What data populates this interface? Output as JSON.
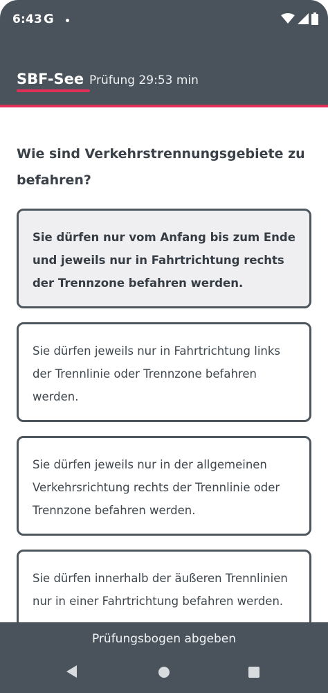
{
  "status_bar": {
    "time": "6:43",
    "google_glyph": "G",
    "icons": [
      "notification-dot",
      "wifi-icon",
      "signal-icon",
      "battery-icon"
    ]
  },
  "header": {
    "brand": "SBF-See",
    "exam_label": "Prüfung",
    "timer": "29:53 min"
  },
  "question": {
    "text": "Wie sind Verkehrstrennungsgebiete zu befahren?"
  },
  "answers": [
    {
      "text": "Sie dürfen nur vom Anfang bis zum Ende und jeweils nur in Fahrtrichtung rechts der Trennzone befahren werden.",
      "selected": true
    },
    {
      "text": "Sie dürfen jeweils nur in Fahrtrichtung links der Trennlinie oder Trennzone befahren werden.",
      "selected": false
    },
    {
      "text": "Sie dürfen jeweils nur in der allgemeinen Verkehrsrichtung rechts der Trennlinie oder Trennzone befahren werden.",
      "selected": false
    },
    {
      "text": "Sie dürfen innerhalb der äußeren Trennlinien nur in einer Fahrtrichtung befahren werden.",
      "selected": false
    }
  ],
  "footer": {
    "submit_label": "Prüfungsbogen abgeben"
  },
  "colors": {
    "header_bg": "#4a535b",
    "accent": "#e0305a",
    "selected_bg": "#efeff1",
    "card_border": "#4d555d"
  }
}
